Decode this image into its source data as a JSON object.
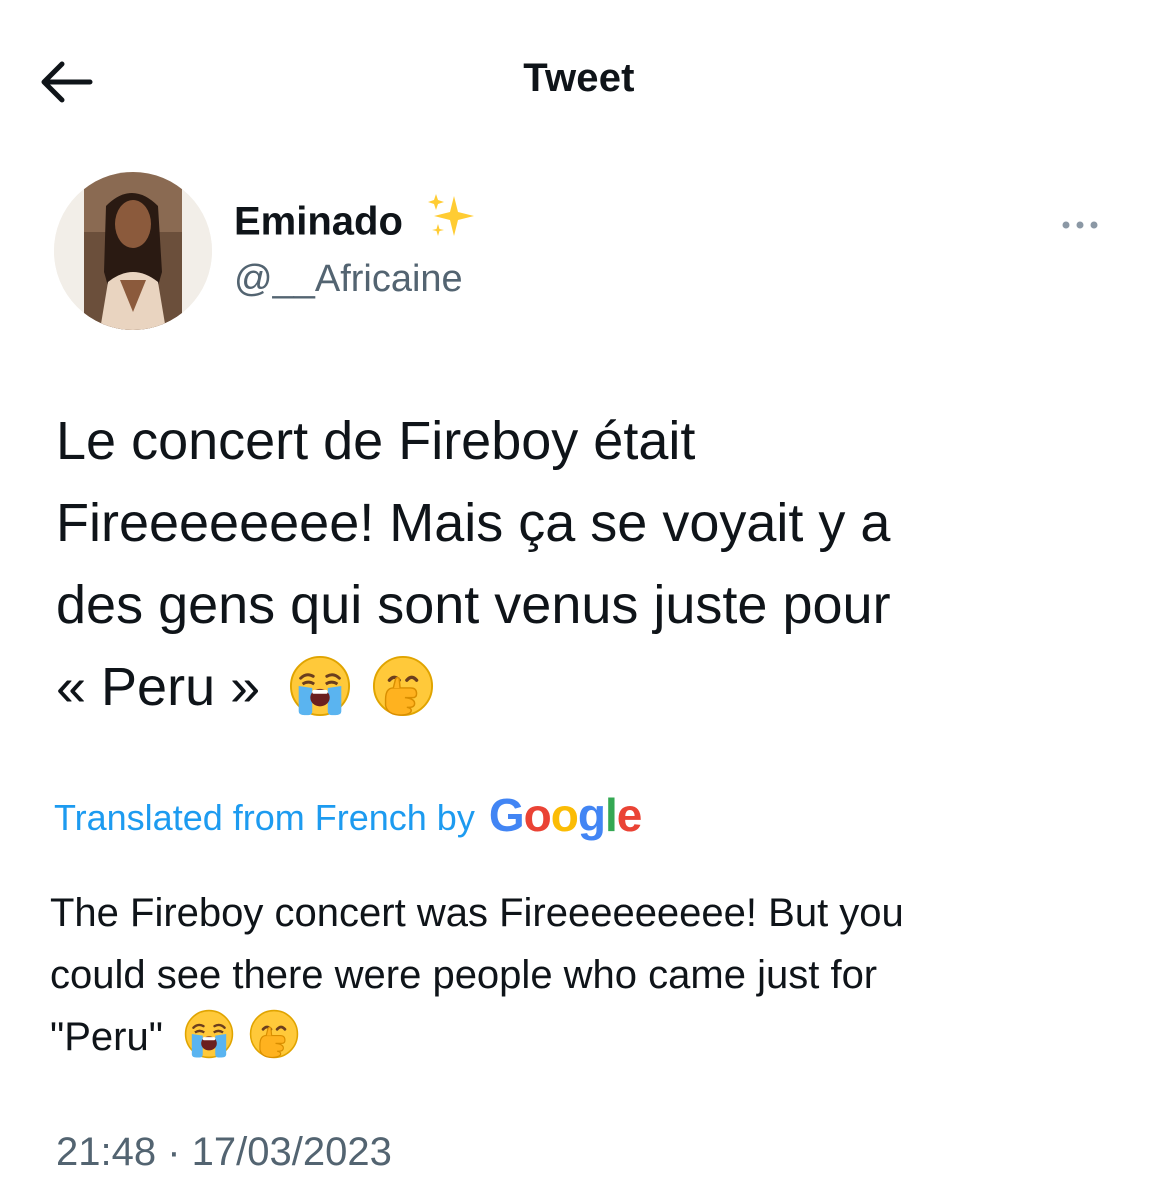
{
  "header": {
    "title": "Tweet",
    "back_icon": "arrow-left-icon"
  },
  "author": {
    "display_name": "Eminado",
    "name_emoji": "sparkles-icon",
    "handle": "@__Africaine"
  },
  "tweet": {
    "text_line_1": "Le concert de Fireboy était",
    "text_line_2": "Fireeeeeeee! Mais ça se voyait y a",
    "text_line_3": "des gens qui sont venus juste pour",
    "text_line_4": "« Peru »",
    "emojis": [
      "loudly-crying-face-icon",
      "face-with-hand-over-mouth-icon"
    ]
  },
  "translation": {
    "label": "Translated from French by",
    "provider": "Google",
    "text_line_1": "The Fireboy concert was Fireeeeeeeee! But you",
    "text_line_2": "could see there were people who came just for",
    "text_line_3": "\"Peru\""
  },
  "meta": {
    "timestamp": "21:48 · 17/03/2023"
  },
  "colors": {
    "text": "#0f1419",
    "secondary": "#536471",
    "link": "#1d9bf0",
    "google_blue": "#4285f4",
    "google_red": "#ea4335",
    "google_yellow": "#fbbc05",
    "google_green": "#34a853"
  }
}
